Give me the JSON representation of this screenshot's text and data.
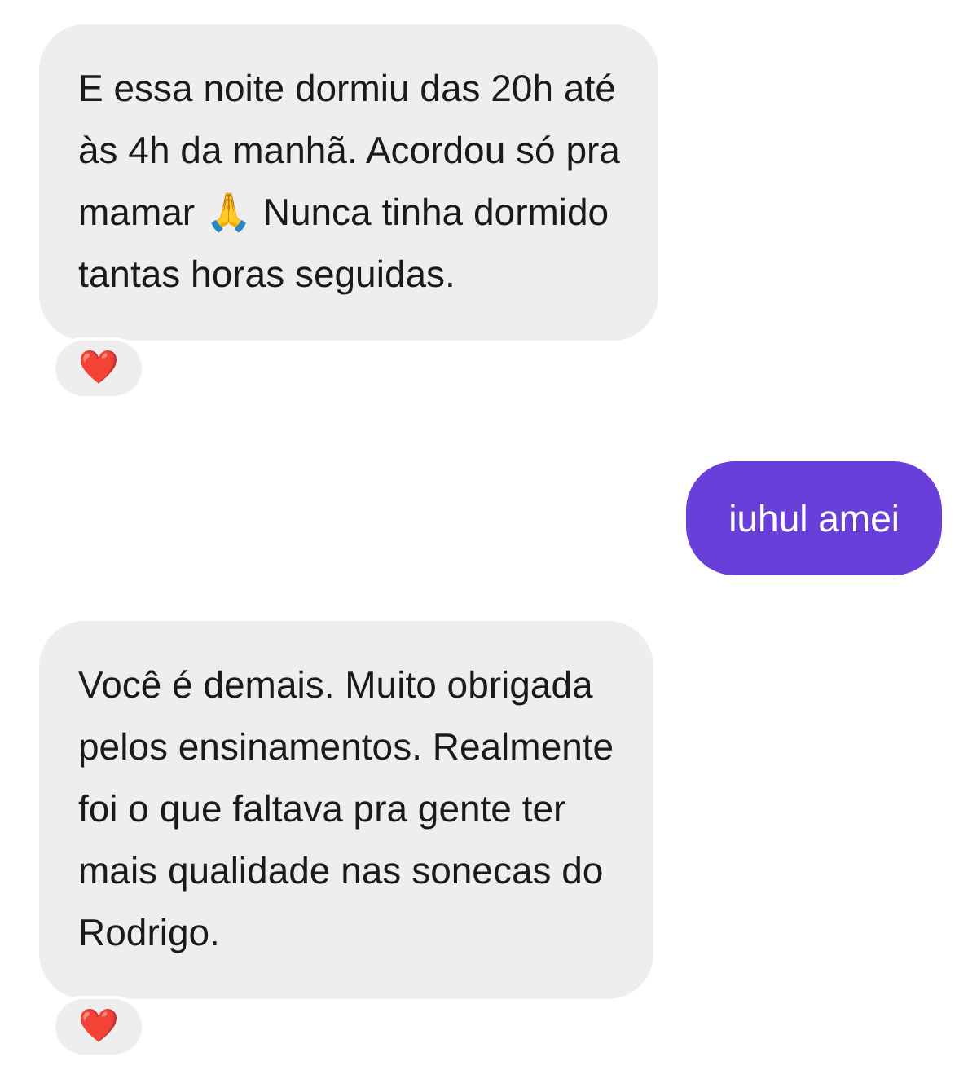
{
  "messages": [
    {
      "kind": "received",
      "text": "E essa noite dormiu das 20h até\nàs 4h da manhã. Acordou só pra\nmamar 🙏 Nunca tinha dormido\ntantas horas seguidas.",
      "reaction": "❤️"
    },
    {
      "kind": "sent",
      "text": "iuhul amei"
    },
    {
      "kind": "received",
      "text": "Você é demais. Muito obrigada\npelos ensinamentos. Realmente\nfoi o que faltava pra gente ter\nmais qualidade nas sonecas do\nRodrigo.",
      "reaction": "❤️"
    }
  ]
}
